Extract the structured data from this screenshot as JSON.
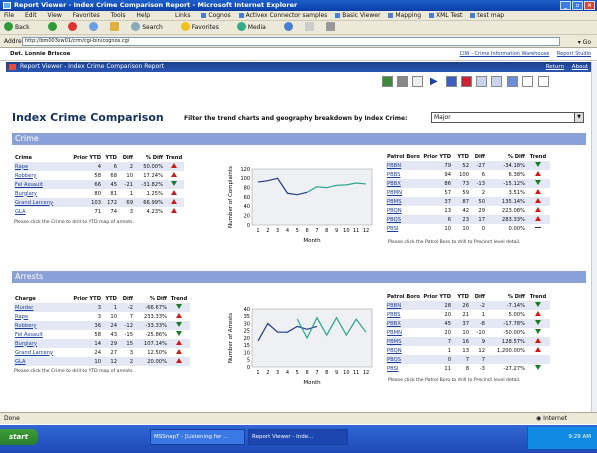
{
  "window": {
    "title": "Report Viewer - Index Crime Comparison Report - Microsoft Internet Explorer"
  },
  "menu": [
    "File",
    "Edit",
    "View",
    "Favorites",
    "Tools",
    "Help"
  ],
  "links_label": "Links",
  "links": [
    "Cognos",
    "Activex Connector samples",
    "Basic Viewer",
    "Mapping",
    "XML Test",
    "test map"
  ],
  "toolbar": {
    "back": "Back",
    "search": "Search",
    "favorites": "Favorites",
    "media": "Media"
  },
  "address": {
    "label": "Address",
    "value": "http://bm003sw01/crm/cgi-bin/cognos.cgi",
    "go": "Go"
  },
  "user": {
    "name": "Det. Lonnie Briscoe",
    "link1": "CIW - Crime Information Warehouse",
    "link2": "Report Studio"
  },
  "report_bar": {
    "title": "Report Viewer - Index Crime Comparison Report",
    "return": "Return",
    "about": "About"
  },
  "report": {
    "title": "Index Crime Comparison",
    "filter_label": "Filter the trend charts and geography breakdown by Index Crime:",
    "filter_value": "Major"
  },
  "crime": {
    "header": "Crime",
    "columns": [
      "Crime",
      "Prior YTD",
      "YTD",
      "Diff",
      "% Diff",
      "Trend"
    ],
    "rows": [
      {
        "name": "Rape",
        "prior": "4",
        "ytd": "6",
        "diff": "2",
        "pct": "50.00%",
        "trend": "up"
      },
      {
        "name": "Robbery",
        "prior": "58",
        "ytd": "68",
        "diff": "10",
        "pct": "17.24%",
        "trend": "up"
      },
      {
        "name": "Fel Assault",
        "prior": "66",
        "ytd": "45",
        "diff": "-21",
        "pct": "-31.82%",
        "trend": "down"
      },
      {
        "name": "Burglary",
        "prior": "80",
        "ytd": "81",
        "diff": "1",
        "pct": "1.25%",
        "trend": "up"
      },
      {
        "name": "Grand Larceny",
        "prior": "103",
        "ytd": "172",
        "diff": "69",
        "pct": "66.99%",
        "trend": "up"
      },
      {
        "name": "GLA",
        "prior": "71",
        "ytd": "74",
        "diff": "3",
        "pct": "4.23%",
        "trend": "up"
      }
    ],
    "note": "Please click the Crime to drill to YTD map of arrests.",
    "boro_columns": [
      "Patrol Boro",
      "Prior YTD",
      "YTD",
      "Diff",
      "% Diff",
      "Trend"
    ],
    "boros": [
      {
        "name": "PBBN",
        "prior": "79",
        "ytd": "52",
        "diff": "-27",
        "pct": "-34.18%",
        "trend": "down"
      },
      {
        "name": "PBBS",
        "prior": "94",
        "ytd": "100",
        "diff": "6",
        "pct": "6.38%",
        "trend": "up"
      },
      {
        "name": "PBBX",
        "prior": "86",
        "ytd": "73",
        "diff": "-13",
        "pct": "-15.12%",
        "trend": "down"
      },
      {
        "name": "PBMN",
        "prior": "57",
        "ytd": "59",
        "diff": "2",
        "pct": "3.51%",
        "trend": "up"
      },
      {
        "name": "PBMS",
        "prior": "37",
        "ytd": "87",
        "diff": "50",
        "pct": "135.14%",
        "trend": "up"
      },
      {
        "name": "PBQN",
        "prior": "13",
        "ytd": "42",
        "diff": "29",
        "pct": "223.08%",
        "trend": "up"
      },
      {
        "name": "PBQS",
        "prior": "6",
        "ytd": "23",
        "diff": "17",
        "pct": "283.33%",
        "trend": "up"
      },
      {
        "name": "PBSI",
        "prior": "10",
        "ytd": "10",
        "diff": "0",
        "pct": "0.00%",
        "trend": "flat"
      }
    ],
    "boro_note": "Please click the Patrol Boro to drill to Precinct level detail."
  },
  "arrests": {
    "header": "Arrests",
    "columns": [
      "Charge",
      "Prior YTD",
      "YTD",
      "Diff",
      "% Diff",
      "Trend"
    ],
    "rows": [
      {
        "name": "Murder",
        "prior": "3",
        "ytd": "1",
        "diff": "-2",
        "pct": "-66.67%",
        "trend": "down"
      },
      {
        "name": "Rape",
        "prior": "3",
        "ytd": "10",
        "diff": "7",
        "pct": "233.33%",
        "trend": "up"
      },
      {
        "name": "Robbery",
        "prior": "36",
        "ytd": "24",
        "diff": "-12",
        "pct": "-33.33%",
        "trend": "down"
      },
      {
        "name": "Fel Assault",
        "prior": "58",
        "ytd": "43",
        "diff": "-15",
        "pct": "-25.86%",
        "trend": "down"
      },
      {
        "name": "Burglary",
        "prior": "14",
        "ytd": "29",
        "diff": "15",
        "pct": "107.14%",
        "trend": "up"
      },
      {
        "name": "Grand Larceny",
        "prior": "24",
        "ytd": "27",
        "diff": "3",
        "pct": "12.50%",
        "trend": "up"
      },
      {
        "name": "GLA",
        "prior": "10",
        "ytd": "12",
        "diff": "2",
        "pct": "20.00%",
        "trend": "up"
      }
    ],
    "note": "Please click the Crime to drill to YTD map of arrests.",
    "boro_columns": [
      "Patrol Boro",
      "Prior YTD",
      "YTD",
      "Diff",
      "% Diff",
      "Trend"
    ],
    "boros": [
      {
        "name": "PBBN",
        "prior": "28",
        "ytd": "26",
        "diff": "-2",
        "pct": "-7.14%",
        "trend": "down"
      },
      {
        "name": "PBBS",
        "prior": "20",
        "ytd": "21",
        "diff": "1",
        "pct": "5.00%",
        "trend": "up"
      },
      {
        "name": "PBBX",
        "prior": "45",
        "ytd": "37",
        "diff": "-8",
        "pct": "-17.78%",
        "trend": "down"
      },
      {
        "name": "PBMN",
        "prior": "20",
        "ytd": "10",
        "diff": "-10",
        "pct": "-50.00%",
        "trend": "down"
      },
      {
        "name": "PBMS",
        "prior": "7",
        "ytd": "16",
        "diff": "9",
        "pct": "128.57%",
        "trend": "up"
      },
      {
        "name": "PBQN",
        "prior": "1",
        "ytd": "13",
        "diff": "12",
        "pct": "1,200.00%",
        "trend": "up"
      },
      {
        "name": "PBQS",
        "prior": "0",
        "ytd": "7",
        "diff": "7",
        "pct": "",
        "trend": ""
      },
      {
        "name": "PBSI",
        "prior": "11",
        "ytd": "8",
        "diff": "-3",
        "pct": "-27.27%",
        "trend": "down"
      }
    ],
    "boro_note": "Please click the Patrol Boro to drill to Precinct level detail."
  },
  "chart_data": [
    {
      "type": "line",
      "xlabel": "Month",
      "ylabel": "Number of Complaints",
      "x": [
        1,
        2,
        3,
        4,
        5,
        6,
        7,
        8,
        9,
        10,
        11,
        12
      ],
      "ylim": [
        0,
        120
      ],
      "yticks": [
        0,
        20,
        40,
        60,
        80,
        100,
        120
      ],
      "series": [
        {
          "values": [
            92,
            95,
            100,
            68,
            65,
            70,
            null,
            null,
            null,
            null,
            null,
            null
          ],
          "color": "#1f3a8a"
        },
        {
          "values": [
            null,
            null,
            null,
            null,
            null,
            70,
            82,
            80,
            85,
            86,
            90,
            88
          ],
          "color": "#2aa58f"
        }
      ]
    },
    {
      "type": "line",
      "xlabel": "Month",
      "ylabel": "Number of Arrests",
      "x": [
        1,
        2,
        3,
        4,
        5,
        6,
        7,
        8,
        9,
        10,
        11,
        12
      ],
      "ylim": [
        0,
        40
      ],
      "yticks": [
        0,
        5,
        10,
        15,
        20,
        25,
        30,
        35,
        40
      ],
      "series": [
        {
          "values": [
            18,
            30,
            24,
            24,
            28,
            26,
            28,
            null,
            null,
            null,
            null,
            null
          ],
          "color": "#1f3a8a"
        },
        {
          "values": [
            null,
            null,
            null,
            null,
            33,
            20,
            34,
            22,
            34,
            22,
            33,
            24
          ],
          "color": "#2aa58f"
        }
      ]
    }
  ],
  "status": {
    "text": "Done",
    "zone": "Internet"
  },
  "taskbar": {
    "start": "start",
    "task1": "MSSnapT - [Listening for ...",
    "task2": "Report Viewer - Inde...",
    "clock": "9:29 AM"
  }
}
